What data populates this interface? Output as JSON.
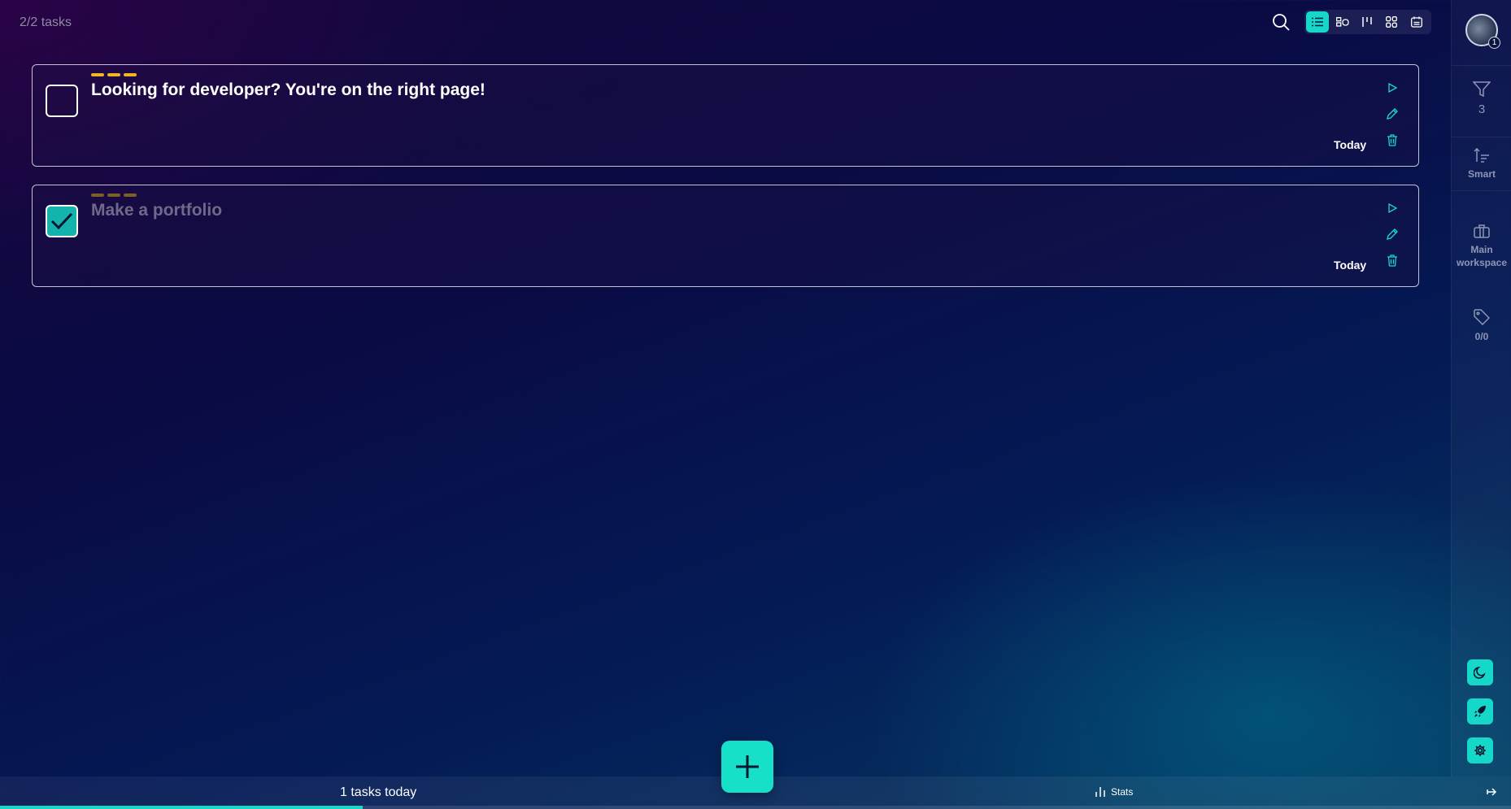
{
  "header": {
    "task_count": "2/2 tasks"
  },
  "views": [
    {
      "icon": "list-icon",
      "active": true
    },
    {
      "icon": "cards-icon",
      "active": false
    },
    {
      "icon": "columns-icon",
      "active": false
    },
    {
      "icon": "grid-icon",
      "active": false
    },
    {
      "icon": "calendar-icon",
      "active": false
    }
  ],
  "tasks": [
    {
      "title": "Looking for developer? You're on the right page!",
      "due": "Today",
      "completed": false,
      "priority_color": "#f3b523"
    },
    {
      "title": "Make a portfolio",
      "due": "Today",
      "completed": true,
      "priority_color": "#7d5f2a"
    }
  ],
  "sidebar": {
    "avatar_badge": "1",
    "filter_count": "3",
    "sort_label": "Smart",
    "workspace_label": "Main workspace",
    "tags_label": "0/0",
    "quick_actions": [
      "moon-icon",
      "rocket-icon",
      "gear-icon"
    ]
  },
  "bottom": {
    "today_count": "1 tasks today",
    "stats_label": "Stats",
    "progress_fraction": 0.24
  },
  "colors": {
    "accent": "#16d8c8",
    "priority": "#f3b523"
  }
}
